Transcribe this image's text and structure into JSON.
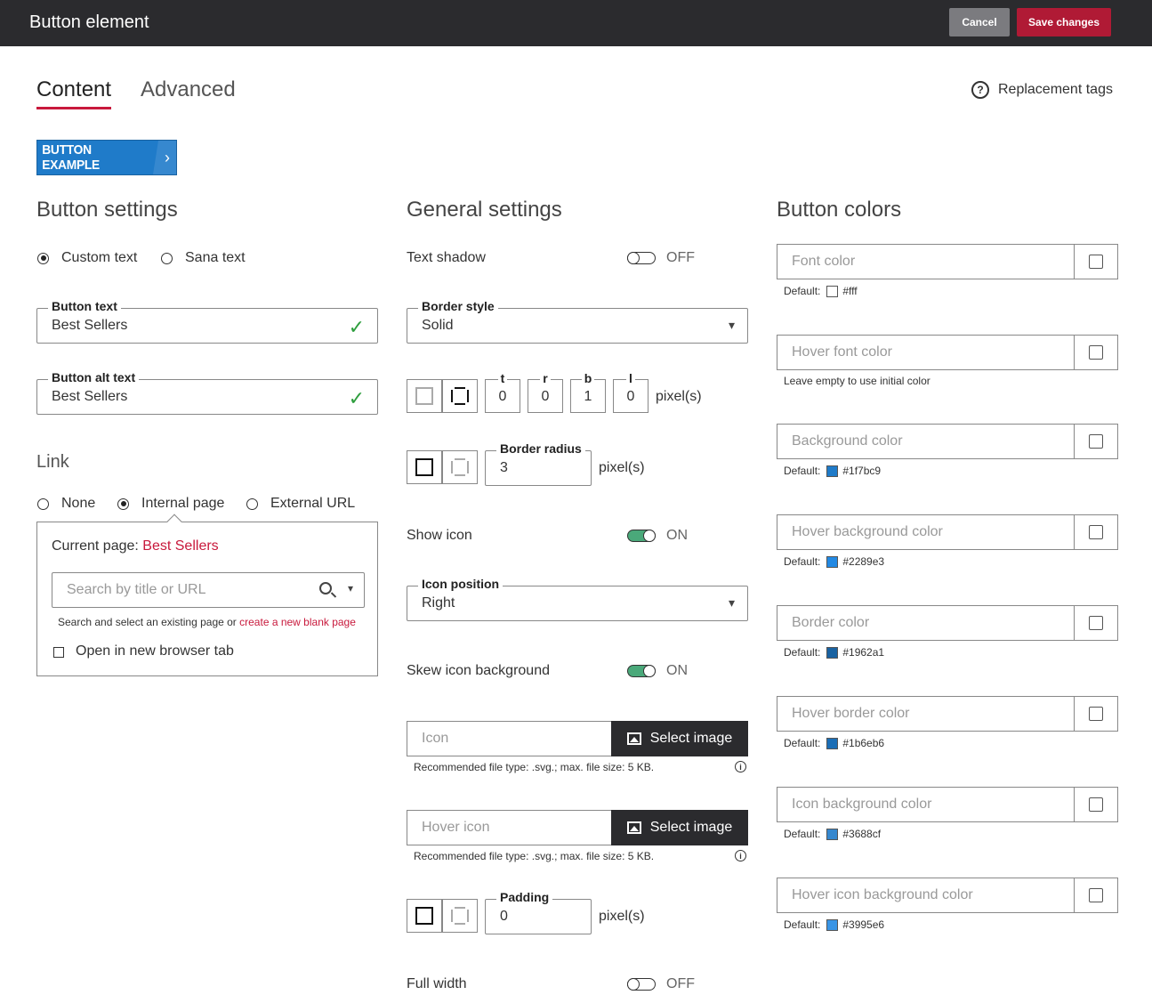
{
  "topbar": {
    "title": "Button element",
    "cancel": "Cancel",
    "save": "Save changes"
  },
  "tabs": {
    "content": "Content",
    "advanced": "Advanced"
  },
  "replacement_tags": "Replacement tags",
  "preview": {
    "label": "BUTTON EXAMPLE",
    "icon": "›"
  },
  "button_settings": {
    "title": "Button settings",
    "radio_custom": "Custom text",
    "radio_sana": "Sana text",
    "button_text_label": "Button text",
    "button_text_value": "Best Sellers",
    "alt_text_label": "Button alt text",
    "alt_text_value": "Best Sellers"
  },
  "link": {
    "title": "Link",
    "radio_none": "None",
    "radio_internal": "Internal page",
    "radio_external": "External URL",
    "current_page_label": "Current page:",
    "current_page_value": "Best Sellers",
    "search_placeholder": "Search by title or URL",
    "hint_text": "Search and select an existing page or",
    "hint_link": "create a new blank page",
    "new_tab": "Open in new browser tab"
  },
  "general": {
    "title": "General settings",
    "text_shadow": "Text shadow",
    "text_shadow_state": "OFF",
    "border_style_label": "Border style",
    "border_style_value": "Solid",
    "border_t_label": "t",
    "border_t": "0",
    "border_r_label": "r",
    "border_r": "0",
    "border_b_label": "b",
    "border_b": "1",
    "border_l_label": "l",
    "border_l": "0",
    "pixels": "pixel(s)",
    "border_radius_label": "Border radius",
    "border_radius_value": "3",
    "show_icon": "Show icon",
    "show_icon_state": "ON",
    "icon_position_label": "Icon position",
    "icon_position_value": "Right",
    "skew_icon": "Skew icon background",
    "skew_icon_state": "ON",
    "icon_placeholder": "Icon",
    "hover_icon_placeholder": "Hover icon",
    "select_image": "Select image",
    "file_hint": "Recommended file type: .svg.; max. file size: 5 KB.",
    "padding_label": "Padding",
    "padding_value": "0",
    "full_width": "Full width",
    "full_width_state": "OFF"
  },
  "colors": {
    "title": "Button colors",
    "default_label": "Default:",
    "font_color": "Font color",
    "font_default": "#fff",
    "font_swatch": "#ffffff",
    "hover_font_color": "Hover font color",
    "hover_font_hint": "Leave empty to use initial color",
    "background_color": "Background color",
    "background_default": "#1f7bc9",
    "hover_background_color": "Hover background color",
    "hover_background_default": "#2289e3",
    "border_color": "Border color",
    "border_default": "#1962a1",
    "hover_border_color": "Hover border color",
    "hover_border_default": "#1b6eb6",
    "icon_background_color": "Icon background color",
    "icon_background_default": "#3688cf",
    "hover_icon_background_color": "Hover icon background color",
    "hover_icon_background_default": "#3995e6"
  }
}
